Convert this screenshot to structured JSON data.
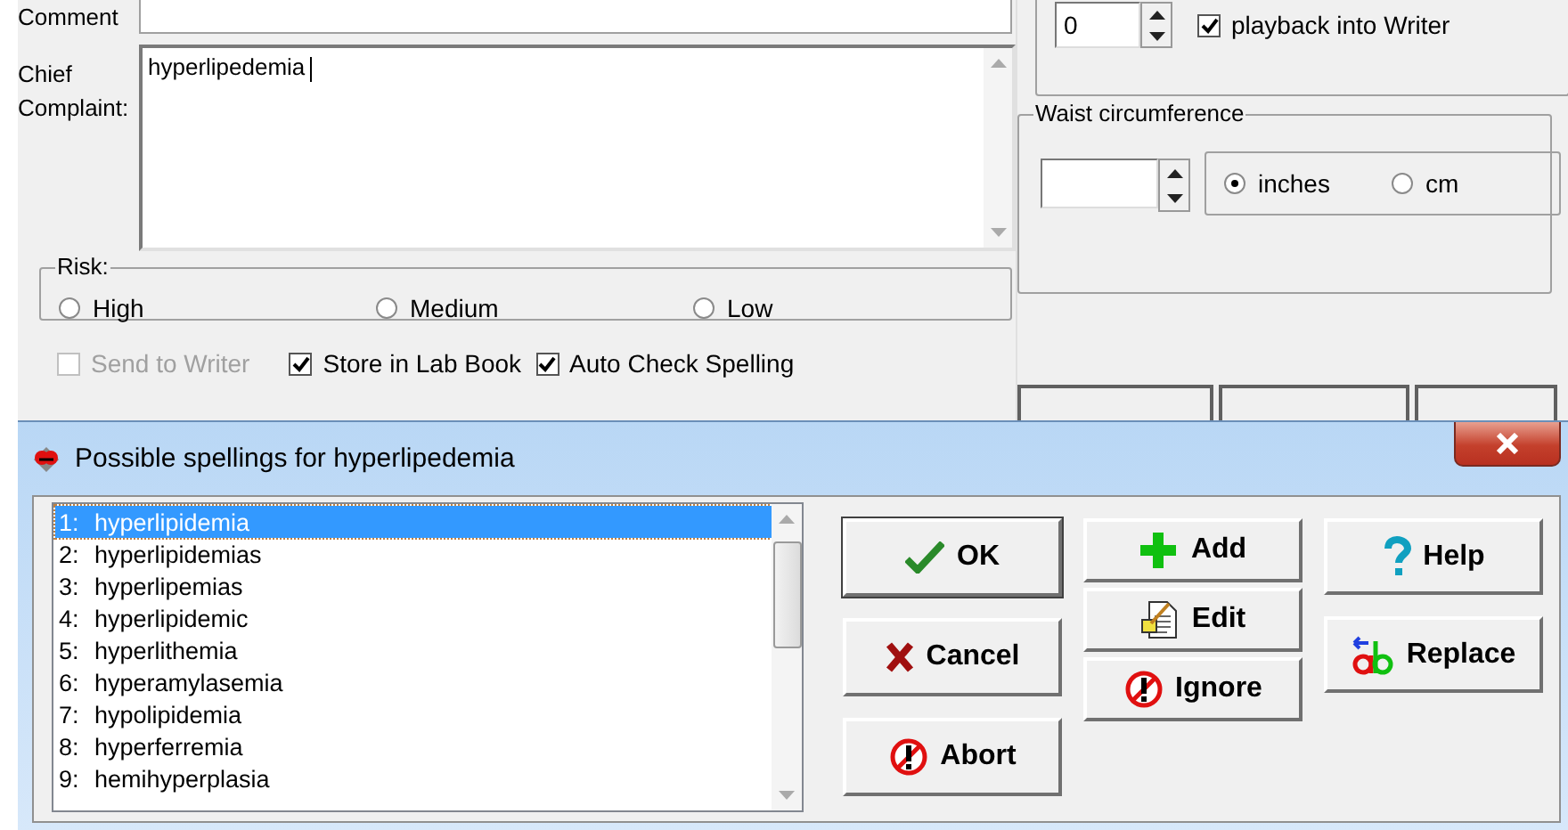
{
  "main_form": {
    "comment_label": "Comment",
    "chief_complaint_label": "Chief Complaint:",
    "chief_complaint_value": "hyperlipedemia",
    "risk": {
      "legend": "Risk:",
      "options": [
        {
          "label": "High",
          "selected": false
        },
        {
          "label": "Medium",
          "selected": false
        },
        {
          "label": "Low",
          "selected": false
        }
      ]
    },
    "checkboxes": [
      {
        "label": "Send to Writer",
        "checked": false,
        "disabled": true
      },
      {
        "label": "Store in Lab Book",
        "checked": true,
        "disabled": false
      },
      {
        "label": "Auto Check Spelling",
        "checked": true,
        "disabled": false
      }
    ],
    "playback": {
      "spinner_value": "0",
      "checkbox": {
        "label": "playback into Writer",
        "checked": true
      }
    },
    "waist": {
      "legend": "Waist circumference",
      "units": [
        {
          "label": "inches",
          "selected": true
        },
        {
          "label": "cm",
          "selected": false
        }
      ]
    }
  },
  "dialog": {
    "title": "Possible spellings for hyperlipedemia",
    "suggestions": [
      {
        "number": "1:",
        "word": "hyperlipidemia",
        "selected": true
      },
      {
        "number": "2:",
        "word": "hyperlipidemias",
        "selected": false
      },
      {
        "number": "3:",
        "word": "hyperlipemias",
        "selected": false
      },
      {
        "number": "4:",
        "word": "hyperlipidemic",
        "selected": false
      },
      {
        "number": "5:",
        "word": "hyperlithemia",
        "selected": false
      },
      {
        "number": "6:",
        "word": "hyperamylasemia",
        "selected": false
      },
      {
        "number": "7:",
        "word": "hypolipidemia",
        "selected": false
      },
      {
        "number": "8:",
        "word": "hyperferremia",
        "selected": false
      },
      {
        "number": "9:",
        "word": "hemihyperplasia",
        "selected": false
      }
    ],
    "buttons": [
      {
        "label": "OK",
        "kind": "ok"
      },
      {
        "label": "Cancel",
        "kind": "cancel"
      },
      {
        "label": "Abort",
        "kind": "abort"
      },
      {
        "label": "Add",
        "kind": "add"
      },
      {
        "label": "Edit",
        "kind": "edit"
      },
      {
        "label": "Ignore",
        "kind": "ignore"
      },
      {
        "label": "Help",
        "kind": "help"
      },
      {
        "label": "Replace",
        "kind": "replace"
      }
    ]
  }
}
